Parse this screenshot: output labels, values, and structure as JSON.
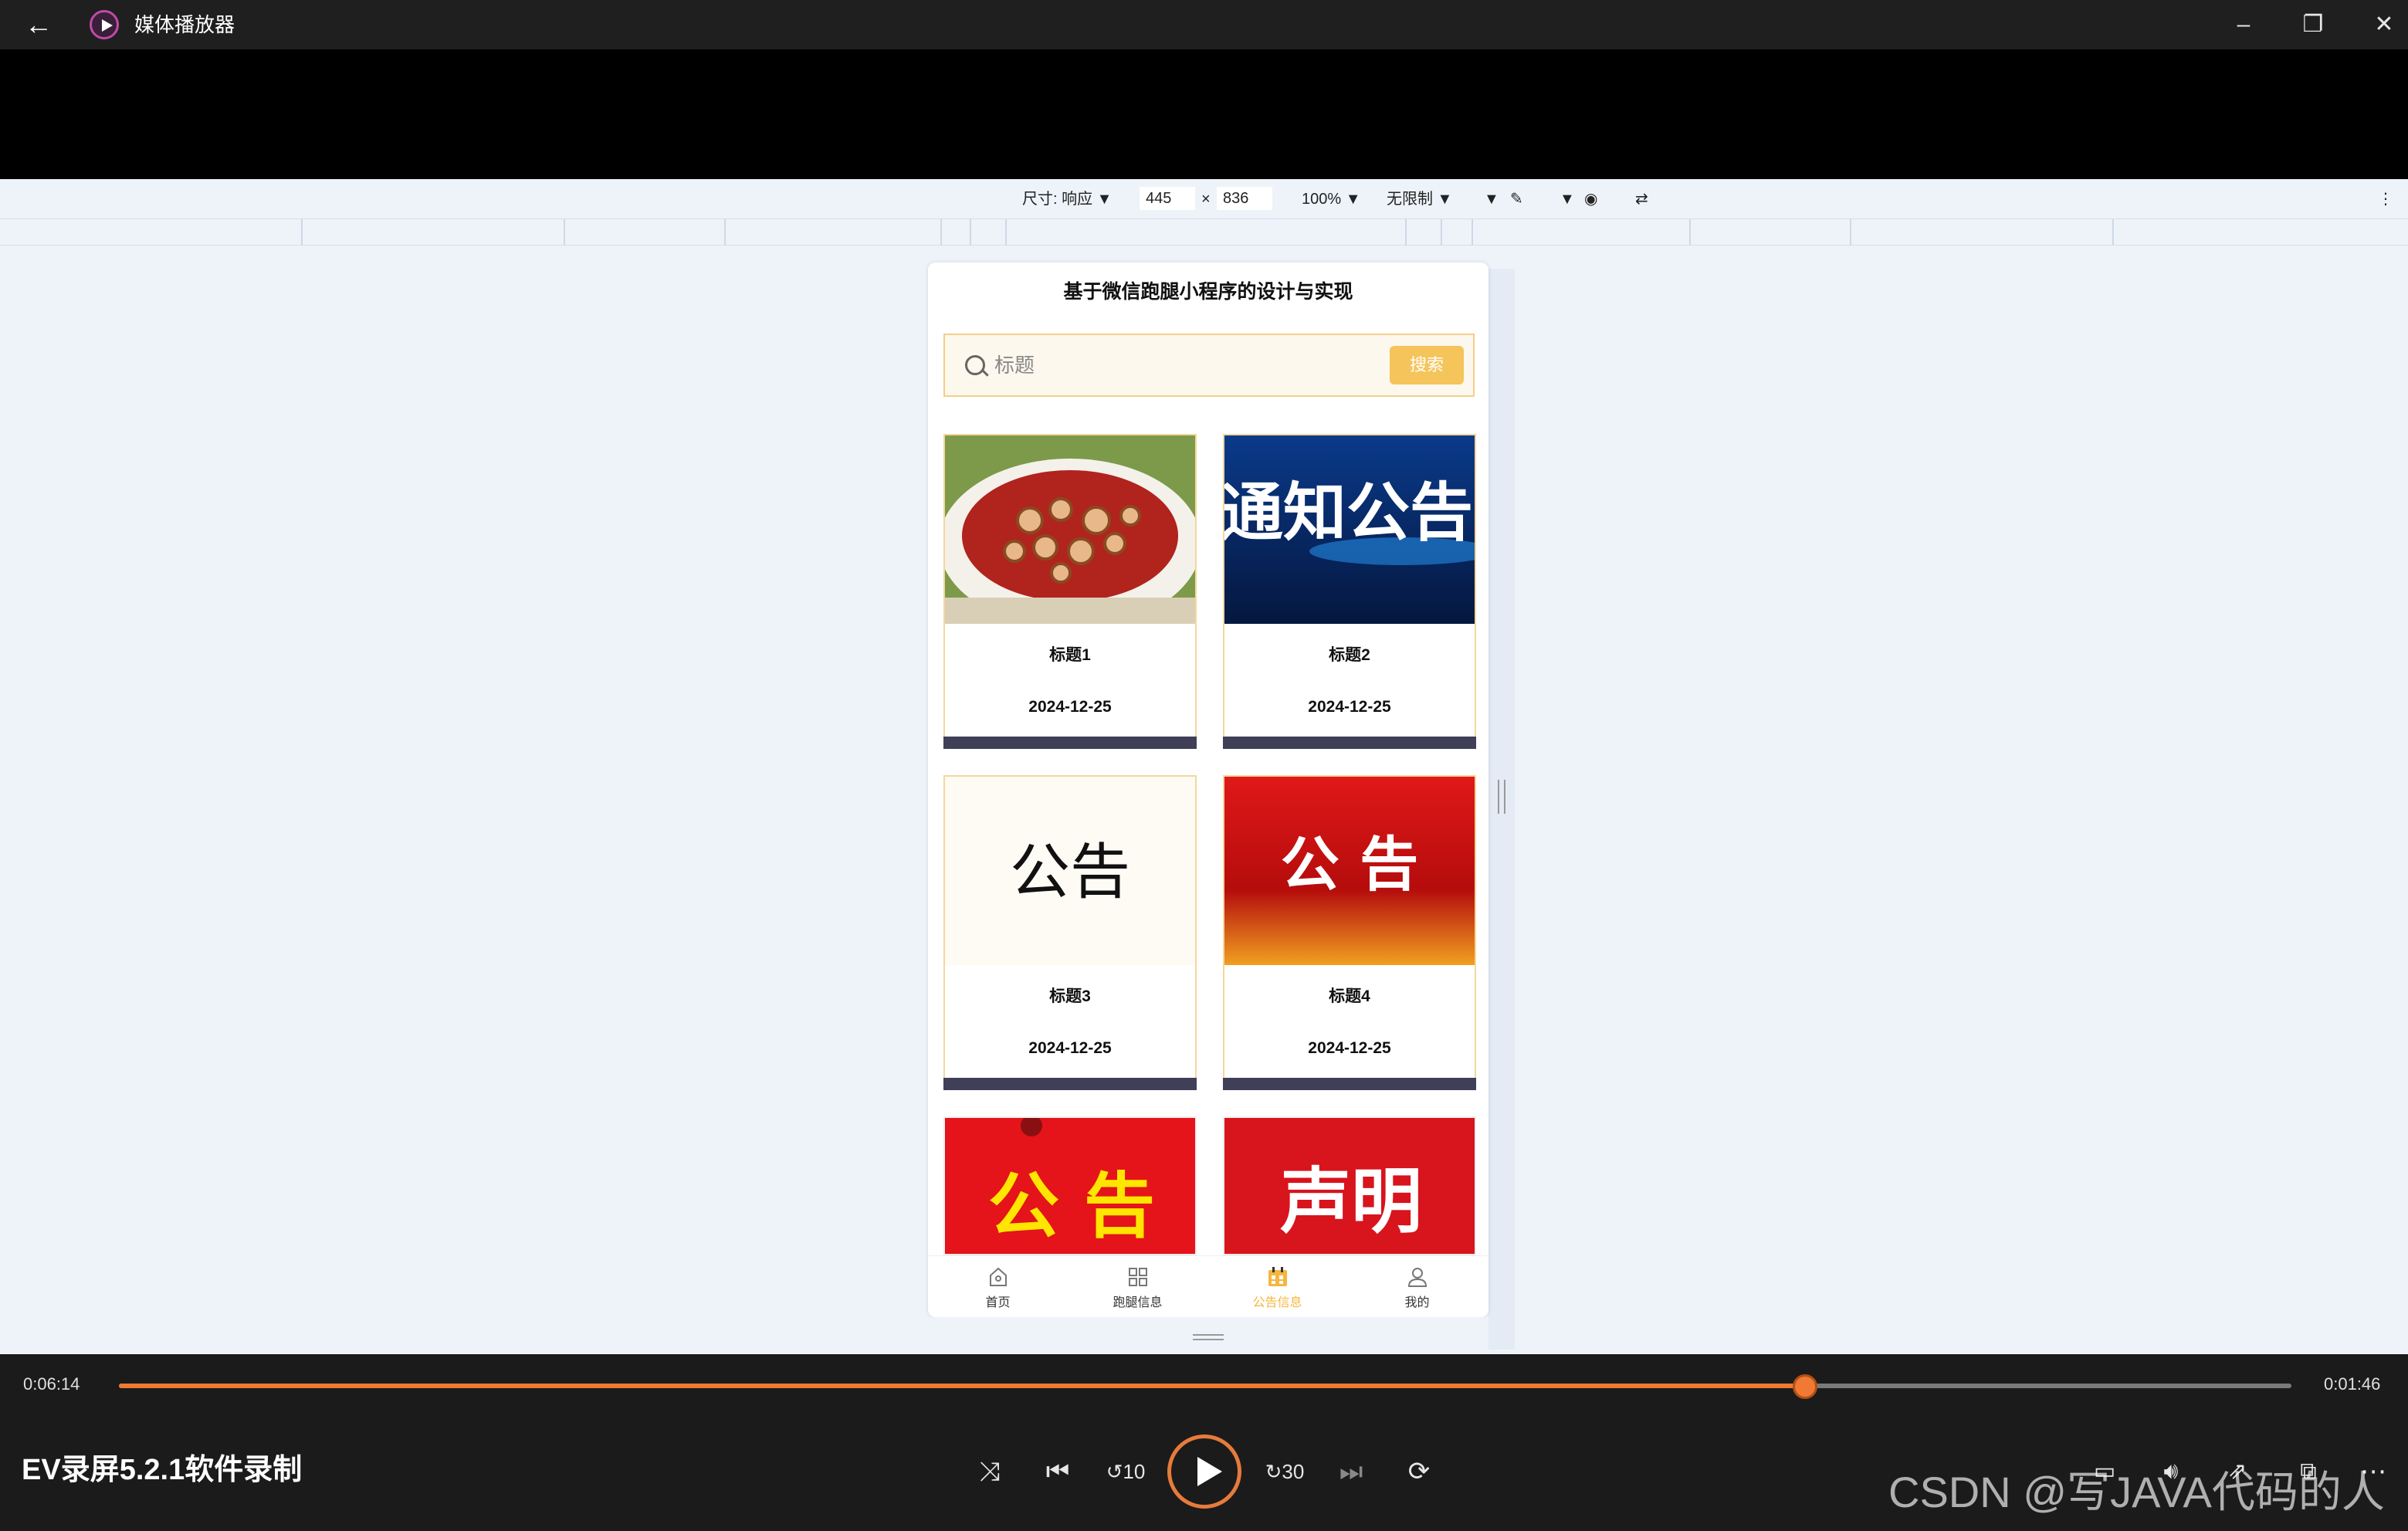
{
  "window": {
    "back_icon": "arrow-left-icon",
    "title": "媒体播放器",
    "minimize_icon": "minimize-icon",
    "restore_icon": "restore-icon",
    "close_icon": "close-icon"
  },
  "devtools": {
    "size_label": "尺寸: 响应",
    "width_value": "445",
    "times_sign": "×",
    "height_value": "836",
    "zoom": "100%",
    "throttle": "无限制"
  },
  "app": {
    "title": "基于微信跑腿小程序的设计与实现",
    "search": {
      "placeholder": "标题",
      "button_label": "搜索"
    },
    "cards": [
      {
        "title": "标题1",
        "date": "2024-12-25",
        "image": "food-dish"
      },
      {
        "title": "标题2",
        "date": "2024-12-25",
        "image": "notice-banner",
        "image_text": "通知公告"
      },
      {
        "title": "标题3",
        "date": "2024-12-25",
        "image": "notice-plain",
        "image_text": "公告"
      },
      {
        "title": "标题4",
        "date": "2024-12-25",
        "image": "notice-red",
        "image_text": "公 告"
      }
    ],
    "partial_cards": [
      {
        "image_text": "公 告"
      },
      {
        "image_text": "声明"
      }
    ],
    "tabs": [
      {
        "label": "首页",
        "icon": "home-icon"
      },
      {
        "label": "跑腿信息",
        "icon": "grid-icon"
      },
      {
        "label": "公告信息",
        "icon": "calendar-icon",
        "active": true
      },
      {
        "label": "我的",
        "icon": "user-icon"
      }
    ]
  },
  "player": {
    "current_time": "0:06:14",
    "total_time": "0:01:46",
    "progress": 0.776,
    "caption": "EV录屏5.2.1软件录制",
    "watermark": "CSDN @写JAVA代码的人",
    "colors": {
      "accent": "#f07a33"
    }
  }
}
